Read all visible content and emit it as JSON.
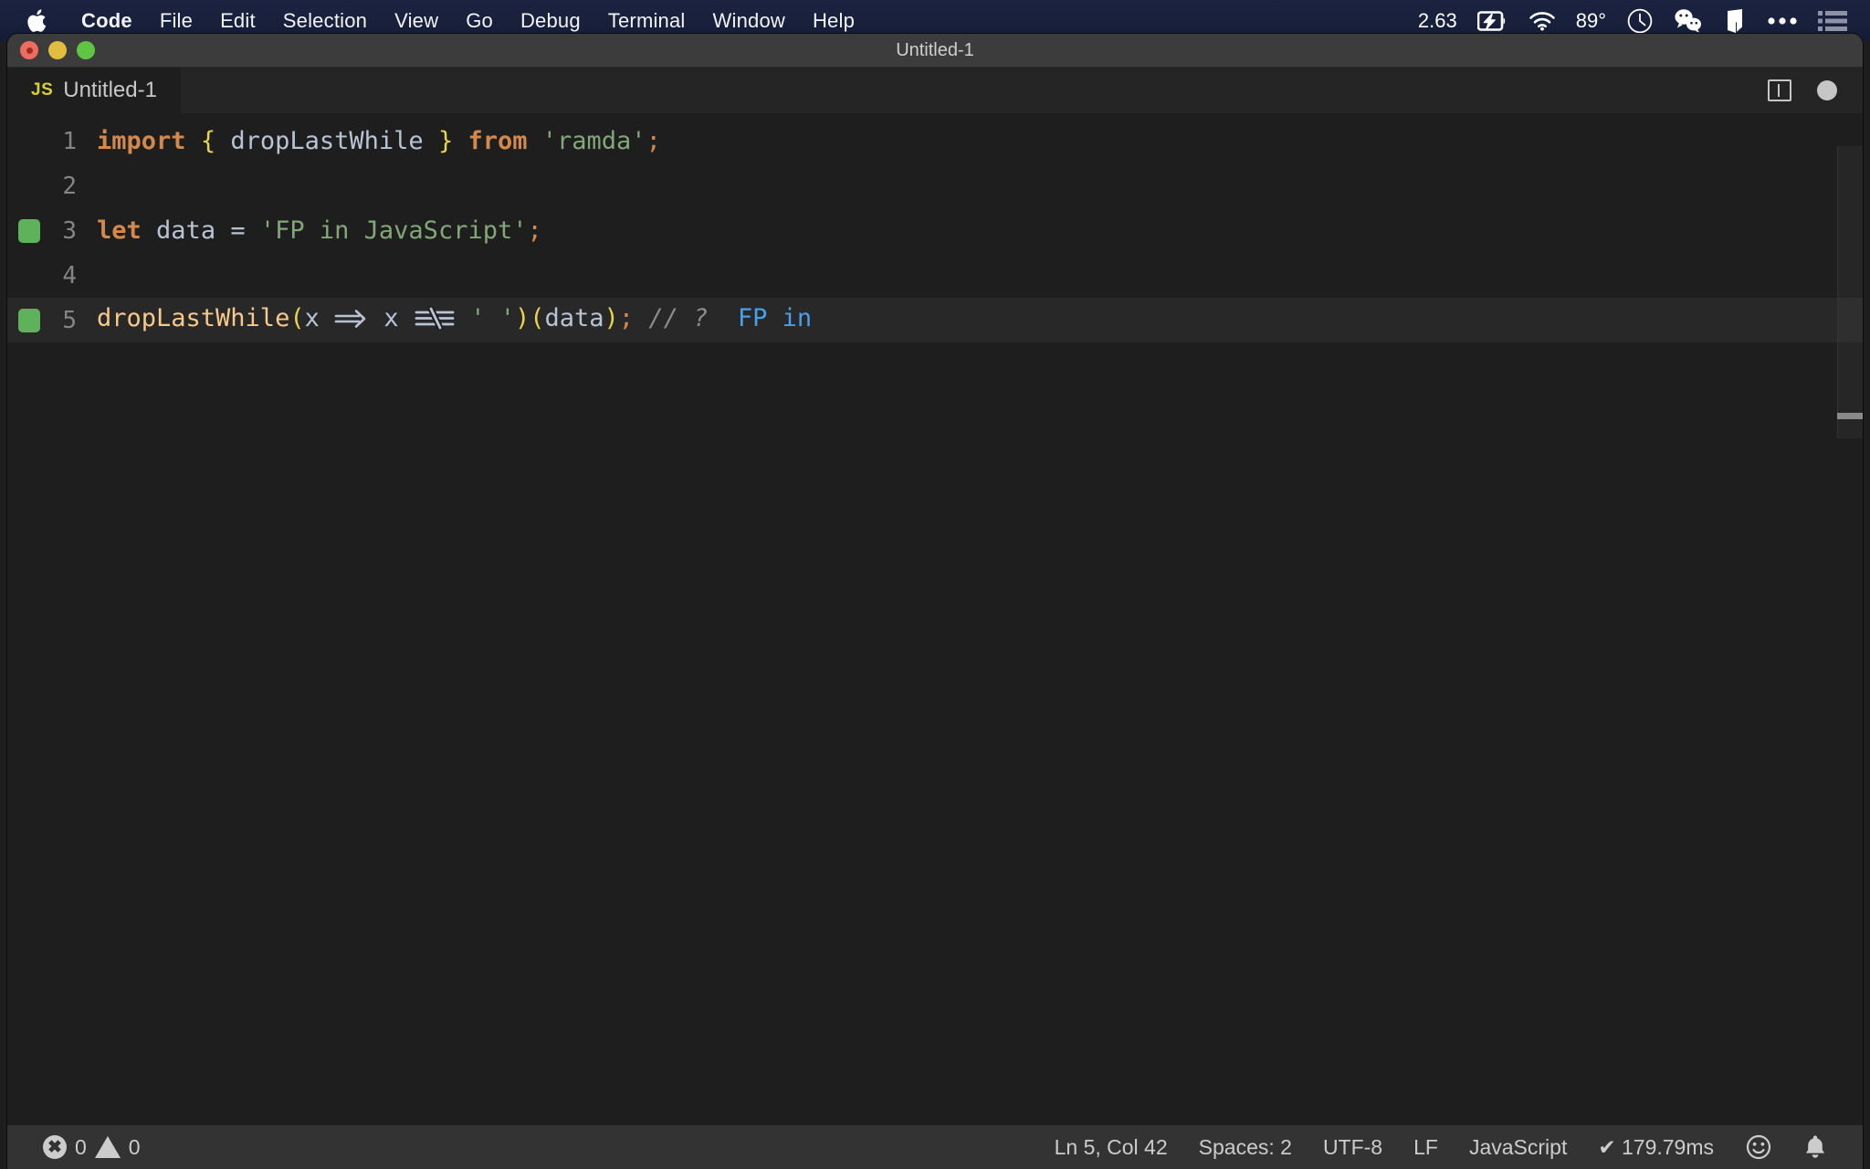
{
  "menubar": {
    "apple_icon": "apple-logo",
    "items": [
      {
        "label": "Code",
        "bold": true
      },
      {
        "label": "File",
        "bold": false
      },
      {
        "label": "Edit",
        "bold": false
      },
      {
        "label": "Selection",
        "bold": false
      },
      {
        "label": "View",
        "bold": false
      },
      {
        "label": "Go",
        "bold": false
      },
      {
        "label": "Debug",
        "bold": false
      },
      {
        "label": "Terminal",
        "bold": false
      },
      {
        "label": "Window",
        "bold": false
      },
      {
        "label": "Help",
        "bold": false
      }
    ],
    "status": {
      "cpu_load": "2.63",
      "battery_icon": "battery-charging-icon",
      "wifi_icon": "wifi-icon",
      "temperature": "89°",
      "clock_icon": "clock-icon",
      "wechat_icon": "wechat-icon",
      "app_icon": "bartender-icon",
      "more_icon": "ellipsis-icon",
      "control_center_icon": "control-center-icon"
    }
  },
  "window": {
    "title": "Untitled-1",
    "traffic_lights": [
      "close-button",
      "minimize-button",
      "maximize-button"
    ]
  },
  "tabbar": {
    "tab": {
      "file_type": "JS",
      "label": "Untitled-1"
    },
    "actions": {
      "split_editor": "split-editor-icon",
      "unsaved": "unsaved-dot-icon"
    }
  },
  "editor": {
    "lines": [
      {
        "num": "1",
        "marker": false,
        "active": false
      },
      {
        "num": "2",
        "marker": false,
        "active": false
      },
      {
        "num": "3",
        "marker": true,
        "active": false
      },
      {
        "num": "4",
        "marker": false,
        "active": false
      },
      {
        "num": "5",
        "marker": true,
        "active": true
      }
    ],
    "code": {
      "line1": {
        "kw_import": "import",
        "brace_open": "{",
        "ident": "dropLastWhile",
        "brace_close": "}",
        "kw_from": "from",
        "module": "'ramda'",
        "semi": ";"
      },
      "line3": {
        "kw_let": "let",
        "ident": "data",
        "eq": "=",
        "str": "'FP in JavaScript'",
        "semi": ";"
      },
      "line5": {
        "fn": "dropLastWhile",
        "paren_open": "(",
        "param": "x",
        "arrow": "=>",
        "param2": "x",
        "neq": "!==",
        "str": "' '",
        "paren_close": ")",
        "paren_open2": "(",
        "arg": "data",
        "paren_close2": ")",
        "semi": ";",
        "comment": "// ?",
        "result": "FP in"
      }
    }
  },
  "statusbar": {
    "errors_icon": "error-icon",
    "errors": "0",
    "warnings_icon": "warning-icon",
    "warnings": "0",
    "cursor": "Ln 5, Col 42",
    "indent": "Spaces: 2",
    "encoding": "UTF-8",
    "eol": "LF",
    "language": "JavaScript",
    "runtime": "✔ 179.79ms",
    "feedback_icon": "smiley-icon",
    "notifications_icon": "bell-icon"
  }
}
